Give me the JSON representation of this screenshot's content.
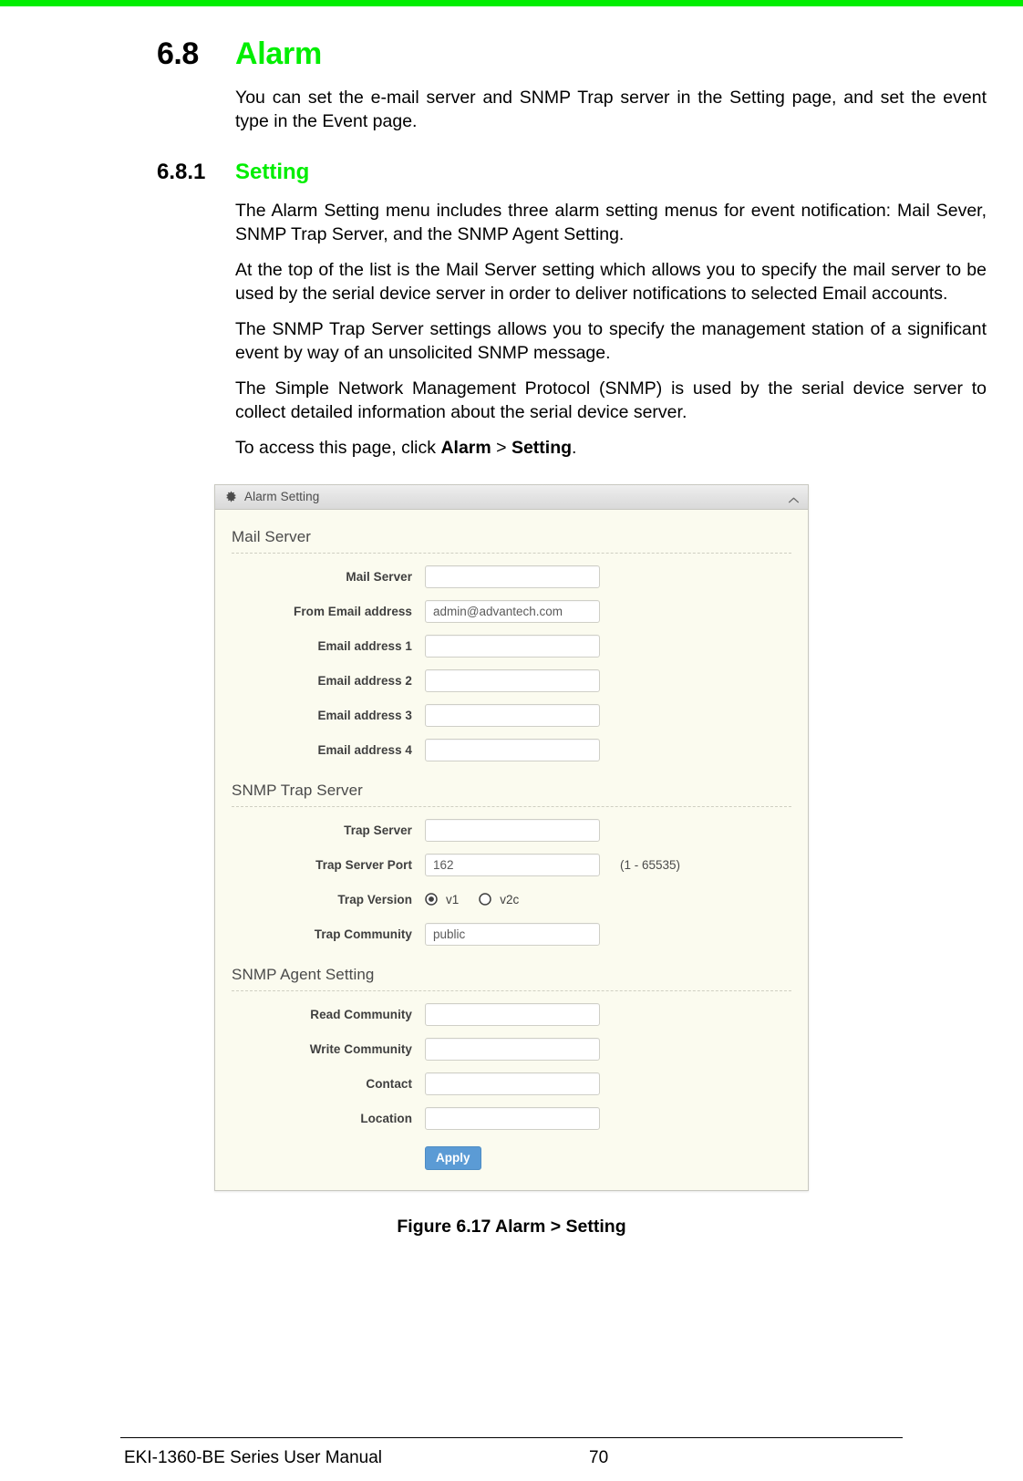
{
  "heading": {
    "number": "6.8",
    "title": "Alarm"
  },
  "intro_paragraph": "You can set the e-mail server and SNMP Trap server in the Setting page, and set the event type in the Event page.",
  "subheading": {
    "number": "6.8.1",
    "title": "Setting"
  },
  "paragraphs": [
    "The Alarm Setting menu includes three alarm setting menus for event notification: Mail Sever, SNMP Trap Server, and the SNMP Agent Setting.",
    "At the top of the list is the Mail Server setting which allows you to specify the mail server to be used by the serial device server in order to deliver notifications to selected Email accounts.",
    "The SNMP Trap Server settings allows you to specify the management station of a significant event by way of an unsolicited SNMP message.",
    "The Simple Network Management Protocol (SNMP) is used by the serial device server to collect detailed information about the serial device server."
  ],
  "access_line": {
    "prefix": "To access this page, click ",
    "bold1": "Alarm",
    "mid": " > ",
    "bold2": "Setting",
    "suffix": "."
  },
  "screenshot": {
    "panel_title": "Alarm Setting",
    "gear_icon": "gear-icon",
    "collapse_icon": "chevron-up-icon",
    "sections": [
      {
        "title": "Mail Server",
        "fields": [
          {
            "label": "Mail Server",
            "value": "",
            "type": "text"
          },
          {
            "label": "From Email address",
            "value": "admin@advantech.com",
            "type": "text"
          },
          {
            "label": "Email address 1",
            "value": "",
            "type": "text"
          },
          {
            "label": "Email address 2",
            "value": "",
            "type": "text"
          },
          {
            "label": "Email address 3",
            "value": "",
            "type": "text"
          },
          {
            "label": "Email address 4",
            "value": "",
            "type": "text"
          }
        ]
      },
      {
        "title": "SNMP Trap Server",
        "fields": [
          {
            "label": "Trap Server",
            "value": "",
            "type": "text"
          },
          {
            "label": "Trap Server Port",
            "value": "162",
            "type": "text",
            "hint": "(1 - 65535)"
          },
          {
            "label": "Trap Version",
            "type": "radio",
            "options": [
              {
                "label": "v1",
                "selected": true
              },
              {
                "label": "v2c",
                "selected": false
              }
            ]
          },
          {
            "label": "Trap Community",
            "value": "public",
            "type": "text"
          }
        ]
      },
      {
        "title": "SNMP Agent Setting",
        "fields": [
          {
            "label": "Read Community",
            "value": "",
            "type": "text"
          },
          {
            "label": "Write Community",
            "value": "",
            "type": "text"
          },
          {
            "label": "Contact",
            "value": "",
            "type": "text"
          },
          {
            "label": "Location",
            "value": "",
            "type": "text"
          }
        ]
      }
    ],
    "apply_label": "Apply"
  },
  "figure_caption": "Figure 6.17 Alarm > Setting",
  "footer": {
    "manual_title": "EKI-1360-BE Series User Manual",
    "page_number": "70"
  },
  "colors": {
    "heading_green": "#00ee00",
    "apply_blue": "#5b9bd5",
    "panel_body": "#fbfbef"
  }
}
